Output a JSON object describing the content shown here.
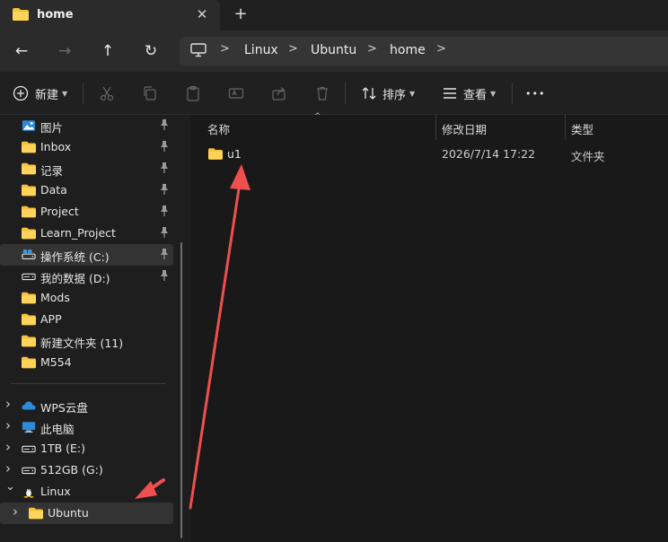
{
  "tab": {
    "title": "home",
    "close_glyph": "✕",
    "new_glyph": "+"
  },
  "nav": {
    "back": "←",
    "forward": "→",
    "up": "↑",
    "refresh": "↻"
  },
  "address": {
    "parts": [
      "Linux",
      "Ubuntu",
      "home"
    ],
    "sep": ">"
  },
  "commands": {
    "new_label": "新建",
    "sort_label": "排序",
    "view_label": "查看",
    "more": "•••"
  },
  "sidebar": {
    "quick": [
      {
        "label": "图片",
        "icon": "picture-icon"
      },
      {
        "label": "Inbox",
        "icon": "folder-icon"
      },
      {
        "label": "记录",
        "icon": "folder-icon"
      },
      {
        "label": "Data",
        "icon": "folder-icon"
      },
      {
        "label": "Project",
        "icon": "folder-icon"
      },
      {
        "label": "Learn_Project",
        "icon": "folder-icon"
      },
      {
        "label": "操作系统 (C:)",
        "icon": "drive-c-icon"
      },
      {
        "label": "我的数据 (D:)",
        "icon": "drive-icon"
      },
      {
        "label": "Mods",
        "icon": "folder-icon"
      },
      {
        "label": "APP",
        "icon": "folder-icon"
      },
      {
        "label": "新建文件夹 (11)",
        "icon": "folder-icon"
      },
      {
        "label": "M554",
        "icon": "folder-icon"
      }
    ],
    "tree": [
      {
        "label": "WPS云盘",
        "icon": "cloud-icon"
      },
      {
        "label": "此电脑",
        "icon": "pc-icon"
      },
      {
        "label": "1TB (E:)",
        "icon": "drive-icon"
      },
      {
        "label": "512GB (G:)",
        "icon": "drive-icon"
      },
      {
        "label": "Linux",
        "icon": "linux-icon"
      },
      {
        "label": "Ubuntu",
        "icon": "folder-icon"
      }
    ]
  },
  "columns": {
    "name": "名称",
    "date": "修改日期",
    "type": "类型"
  },
  "files": [
    {
      "name": "u1",
      "date": "2026/7/14 17:22",
      "type": "文件夹"
    }
  ],
  "colors": {
    "folder": "#f5c33b",
    "annotation": "#ef4f4f"
  }
}
